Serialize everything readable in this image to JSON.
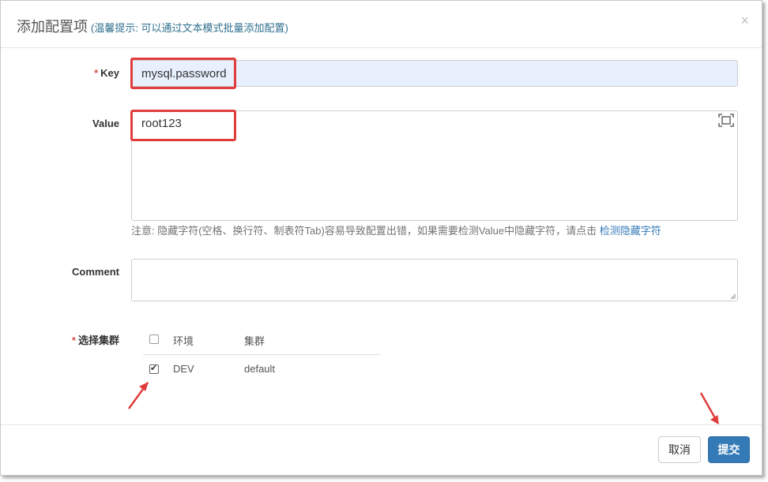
{
  "header": {
    "title": "添加配置项",
    "hint": "(温馨提示: 可以通过文本模式批量添加配置)",
    "close_icon": "close-icon"
  },
  "form": {
    "key_label": "Key",
    "key_value": "mysql.password",
    "value_label": "Value",
    "value_value": "root123",
    "note_text": "注意: 隐藏字符(空格、换行符、制表符Tab)容易导致配置出错，如果需要检测Value中隐藏字符，请点击",
    "note_link": "检测隐藏字符",
    "comment_label": "Comment",
    "comment_value": "",
    "cluster_label": "选择集群",
    "required_mark": "*"
  },
  "cluster_table": {
    "headers": [
      "环境",
      "集群"
    ],
    "rows": [
      {
        "env": "DEV",
        "cluster": "default",
        "checked": true
      }
    ],
    "select_all_checked": false
  },
  "footer": {
    "cancel_label": "取消",
    "submit_label": "提交"
  },
  "colors": {
    "highlight": "#e03c3c",
    "primary": "#337ab7",
    "required": "#d9534f",
    "key_input_bg": "#e8f0fe"
  }
}
